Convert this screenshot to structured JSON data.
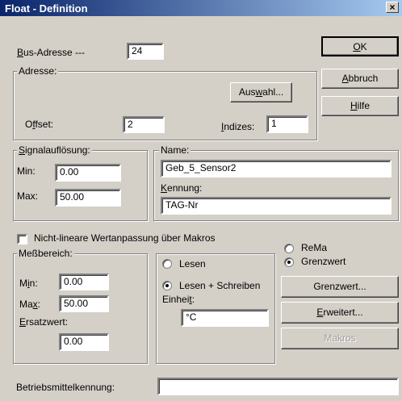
{
  "window": {
    "title": "Float - Definition",
    "close_glyph": "×"
  },
  "bus": {
    "label_prefix": "B",
    "label_rest": "us-Adresse ---",
    "value": "24"
  },
  "adresse": {
    "legend": "Adresse:",
    "auswahl_pre": "Aus",
    "auswahl_u": "w",
    "auswahl_post": "ahl...",
    "offset_pre": "O",
    "offset_u": "f",
    "offset_post": "fset:",
    "offset_value": "2",
    "indizes_u": "I",
    "indizes_post": "ndizes:",
    "indizes_value": "1"
  },
  "buttons": {
    "ok_u": "O",
    "ok_post": "K",
    "abbruch_u": "A",
    "abbruch_post": "bbruch",
    "hilfe_u": "H",
    "hilfe_post": "ilfe"
  },
  "signal": {
    "legend_u": "S",
    "legend_post": "ignalauflösung:",
    "min_label": "Min:",
    "min_value": "0.00",
    "max_label": "Max:",
    "max_value": "50.00"
  },
  "name": {
    "legend": "Name:",
    "name_value": "Geb_5_Sensor2",
    "kennung_u": "K",
    "kennung_post": "ennung:",
    "kennung_value": "TAG-Nr"
  },
  "nonlinear": {
    "label": "Nicht-lineare Wertanpassung über Makros",
    "checked": false
  },
  "messbereich": {
    "legend": "Meßbereich:",
    "min_pre": "M",
    "min_u": "i",
    "min_post": "n:",
    "min_value": "0.00",
    "max_pre": "Ma",
    "max_u": "x",
    "max_post": ":",
    "max_value": "50.00",
    "ersatz_u": "E",
    "ersatz_post": "rsatzwert:",
    "ersatz_value": "0.00"
  },
  "access": {
    "lesen": "Lesen",
    "lesen_schreiben": "Lesen + Schreiben",
    "selected": "lesen_schreiben",
    "einheit_pre": "Einhei",
    "einheit_u": "t",
    "einheit_post": ":",
    "einheit_value": "°C"
  },
  "mode": {
    "rema": "ReMa",
    "grenzwert": "Grenzwert",
    "selected": "grenzwert"
  },
  "side_buttons": {
    "grenzwert": "Grenzwert...",
    "erweitert_u": "E",
    "erweitert_post": "rweitert...",
    "makros": "Makros"
  },
  "betriebsmittel": {
    "label": "Betriebsmittelkennung:",
    "value": ""
  }
}
